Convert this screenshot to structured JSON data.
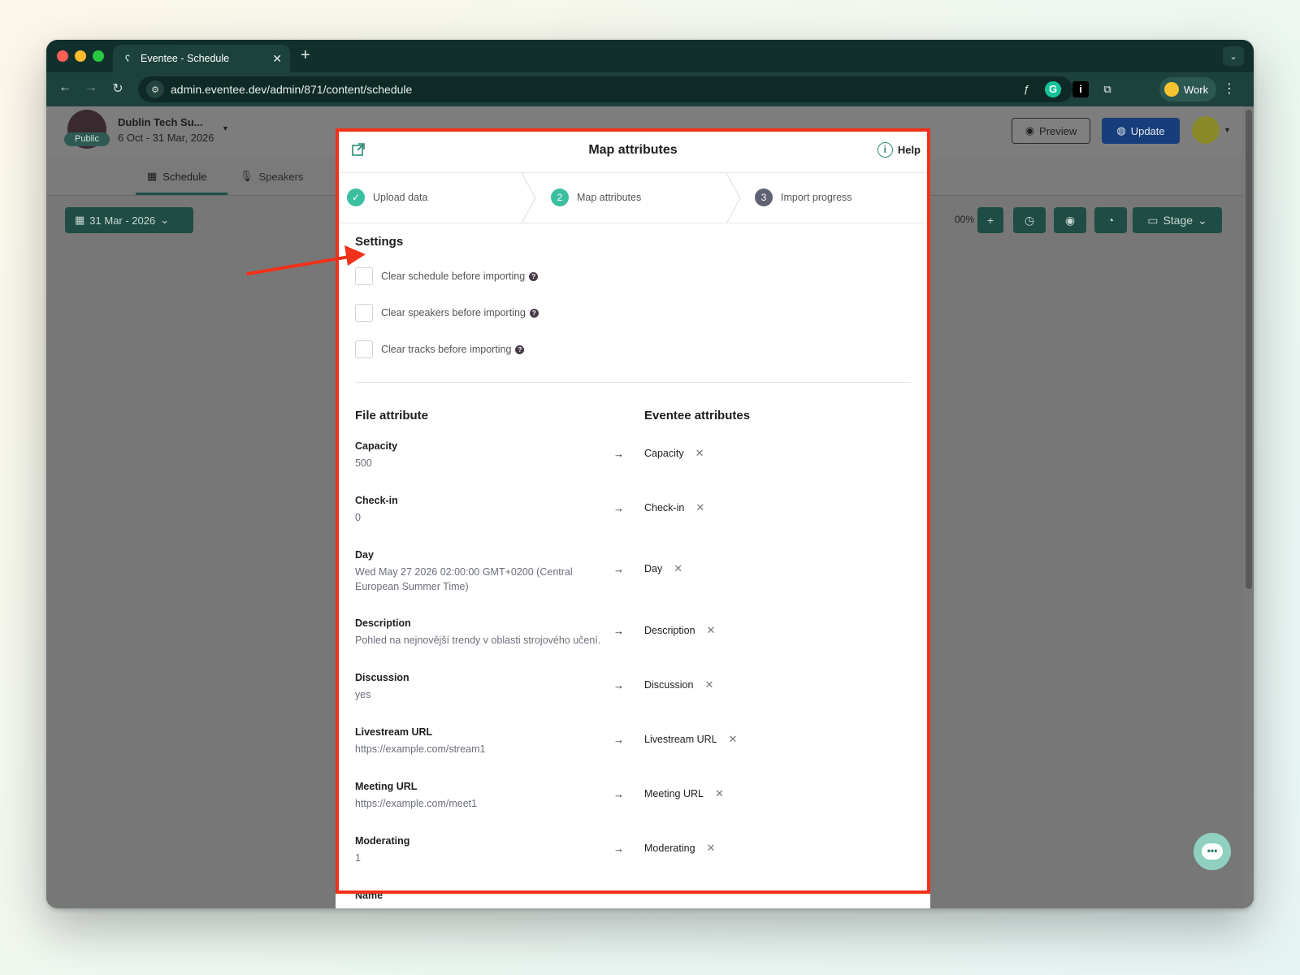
{
  "browser": {
    "tab_title": "Eventee - Schedule",
    "new_tab": "+",
    "url": "admin.eventee.dev/admin/871/content/schedule",
    "profile_label": "Work"
  },
  "app": {
    "event_name": "Dublin Tech Su...",
    "event_dates": "6 Oct - 31 Mar, 2026",
    "public_badge": "Public",
    "preview_label": "Preview",
    "update_label": "Update",
    "subnav": {
      "schedule": "Schedule",
      "speakers": "Speakers"
    },
    "date_button": "31 Mar - 2026",
    "zoom_label": "00%",
    "stage_button": "Stage"
  },
  "modal": {
    "title": "Map attributes",
    "help_label": "Help",
    "steps": [
      {
        "num": "✓",
        "label": "Upload data"
      },
      {
        "num": "2",
        "label": "Map attributes"
      },
      {
        "num": "3",
        "label": "Import progress"
      }
    ],
    "settings_title": "Settings",
    "settings": [
      {
        "label": "Clear schedule before importing"
      },
      {
        "label": "Clear speakers before importing"
      },
      {
        "label": "Clear tracks before importing"
      }
    ],
    "file_attribute_title": "File attribute",
    "eventee_attributes_title": "Eventee attributes",
    "rows": [
      {
        "name": "Capacity",
        "value": "500",
        "target": "Capacity"
      },
      {
        "name": "Check-in",
        "value": "0",
        "target": "Check-in"
      },
      {
        "name": "Day",
        "value": "Wed May 27 2026 02:00:00 GMT+0200 (Central European Summer Time)",
        "target": "Day"
      },
      {
        "name": "Description",
        "value": "Pohled na nejnovější trendy v oblasti strojového učení.",
        "target": "Description"
      },
      {
        "name": "Discussion",
        "value": "yes",
        "target": "Discussion"
      },
      {
        "name": "Livestream URL",
        "value": "https://example.com/stream1",
        "target": "Livestream URL"
      },
      {
        "name": "Meeting URL",
        "value": "https://example.com/meet1",
        "target": "Meeting URL"
      },
      {
        "name": "Moderating",
        "value": "1",
        "target": "Moderating"
      },
      {
        "name": "Name",
        "value": "",
        "target": ""
      }
    ]
  },
  "colors": {
    "brand_green": "#1f4d45",
    "accent_teal": "#3cbf9e",
    "highlight_red": "#f1311a",
    "update_blue": "#173e7a"
  }
}
